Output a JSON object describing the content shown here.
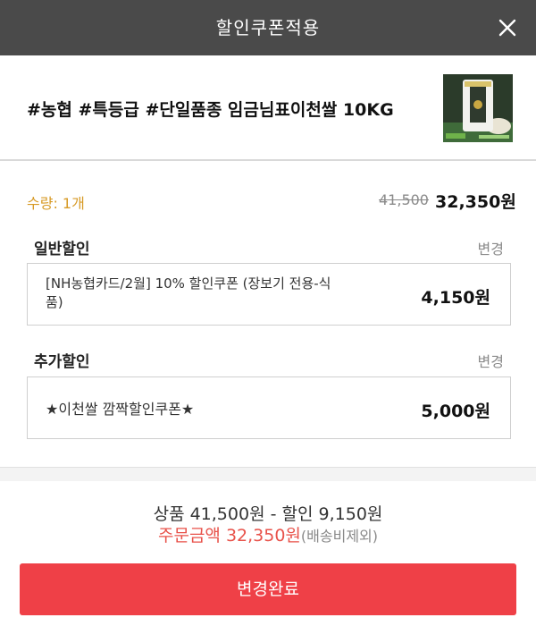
{
  "header": {
    "title": "할인쿠폰적용",
    "close_icon": "close-icon"
  },
  "product": {
    "name": "#농협 #특등급 #단일품종 임금님표이천쌀 10KG",
    "thumbnail_icon": "rice-bag-image"
  },
  "price": {
    "quantity": "수량: 1개",
    "original": "41,500",
    "final": "32,350원"
  },
  "general_discount": {
    "label": "일반할인",
    "change": "변경",
    "coupon_line1": "[NH농협카드/2월] 10% 할인쿠폰 (장보기 전용-식",
    "coupon_line2": "품)",
    "amount": "4,150원"
  },
  "additional_discount": {
    "label": "추가할인",
    "change": "변경",
    "coupon": "★이천쌀 깜짝할인쿠폰★",
    "amount": "5,000원"
  },
  "summary": {
    "product_price": "상품 41,500원",
    "separator": "-",
    "discount": "할인 9,150원",
    "total_label": "주문금액",
    "total_value": "32,350원",
    "shipping_note": "(배송비제외)"
  },
  "confirm_button": "변경완료",
  "colors": {
    "header_bg": "#4a4a4a",
    "accent_red": "#ef4047",
    "quantity_gold": "#d79a26"
  }
}
